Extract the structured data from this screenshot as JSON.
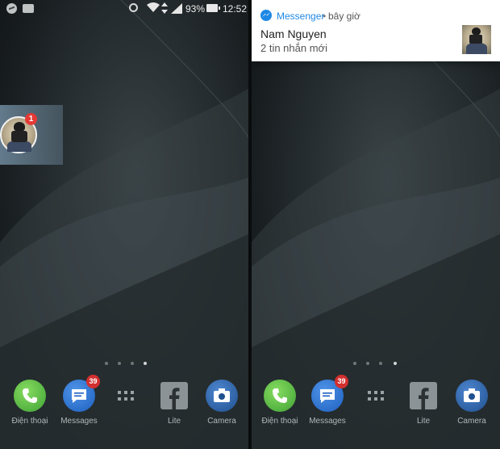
{
  "status_bar": {
    "battery": "93%",
    "time": "12:52"
  },
  "chat_head": {
    "badge": "1"
  },
  "notification": {
    "app": "Messenger",
    "separator": "•",
    "time": "bây giờ",
    "title": "Nam Nguyen",
    "body": "2 tin nhắn mới"
  },
  "dock": {
    "phone": "Điện thoại",
    "messages": "Messages",
    "messages_badge": "39",
    "facebook": "Lite",
    "camera": "Camera"
  },
  "icons": [
    "messenger-icon",
    "mail-icon",
    "alarm-icon",
    "wifi-icon",
    "signal-icon",
    "battery-icon",
    "phone-icon",
    "messages-icon",
    "app-drawer-icon",
    "facebook-icon",
    "camera-icon"
  ],
  "colors": {
    "messenger_blue": "#1e88e5",
    "badge_red": "#e53935",
    "phone_green": "#4caf50"
  }
}
